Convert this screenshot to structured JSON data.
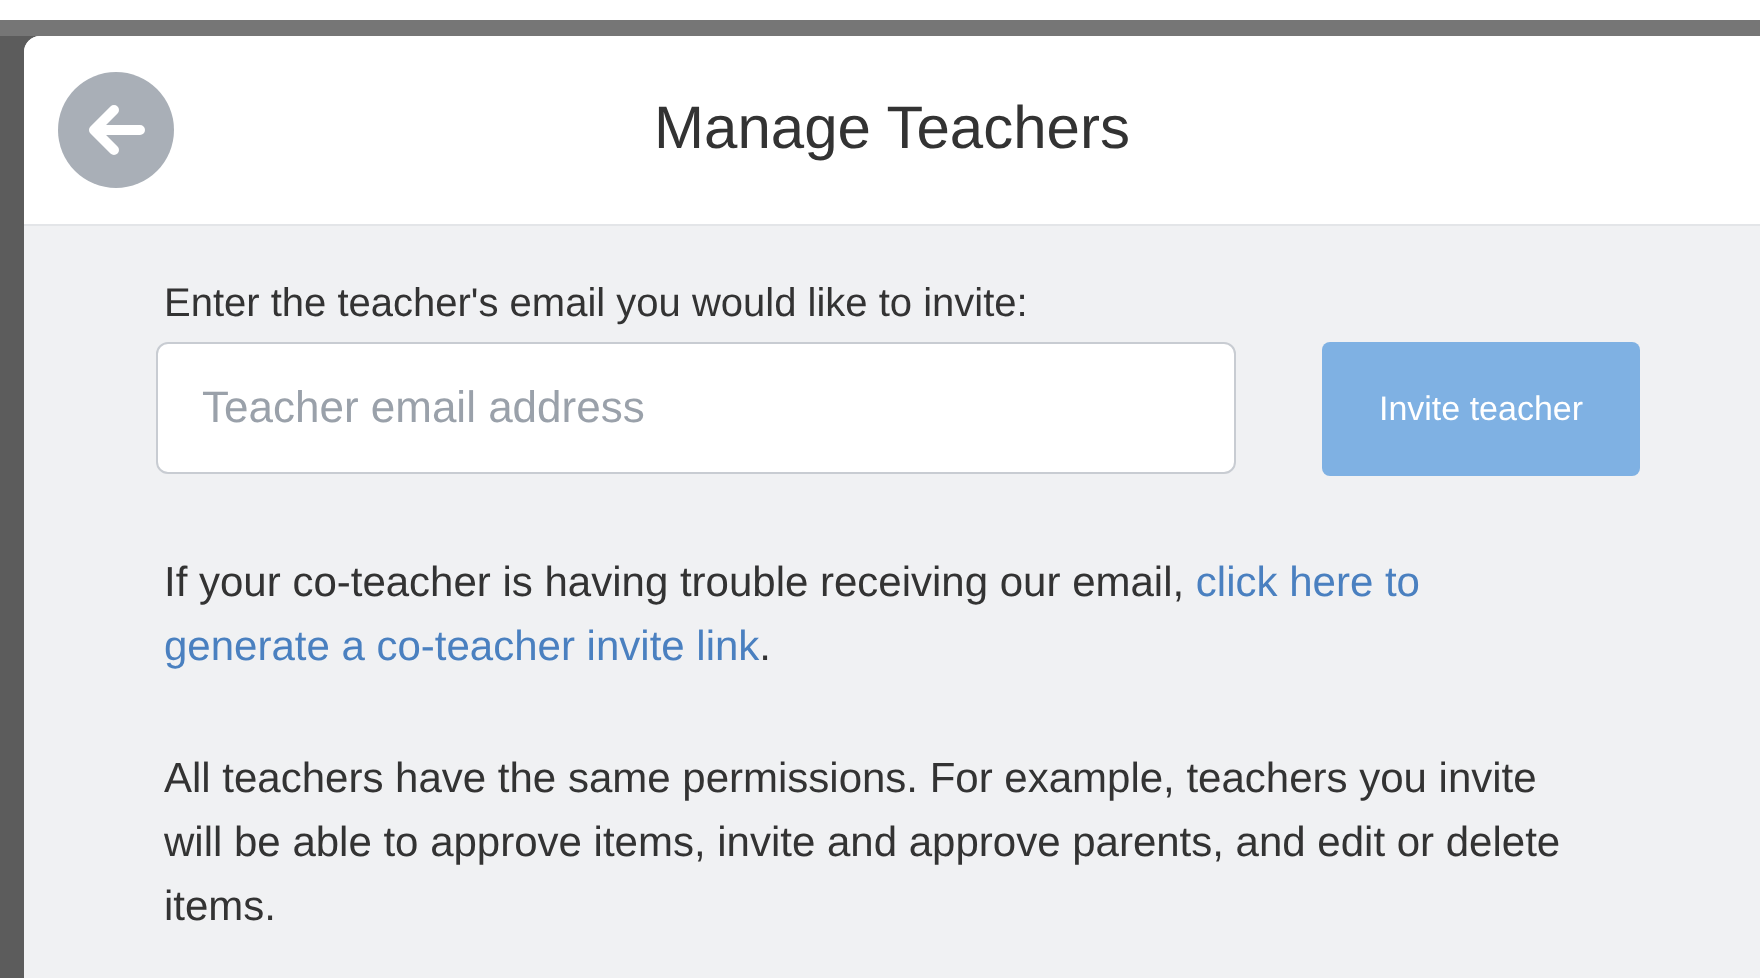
{
  "modal": {
    "title": "Manage Teachers",
    "invite_label": "Enter the teacher's email you would like to invite:",
    "email_field": {
      "placeholder": "Teacher email address"
    },
    "invite_button": {
      "label": "Invite teacher",
      "disabled": true
    },
    "help_text": {
      "before": "If your co-teacher is having trouble receiving our email, ",
      "link_lines": [
        "click here to",
        "generate a co-teacher invite link"
      ],
      "after": "."
    },
    "permissions_text": "All teachers have the same permissions. For example, teachers you invite will be able to approve items, invite and approve parents, and edit or delete items."
  }
}
